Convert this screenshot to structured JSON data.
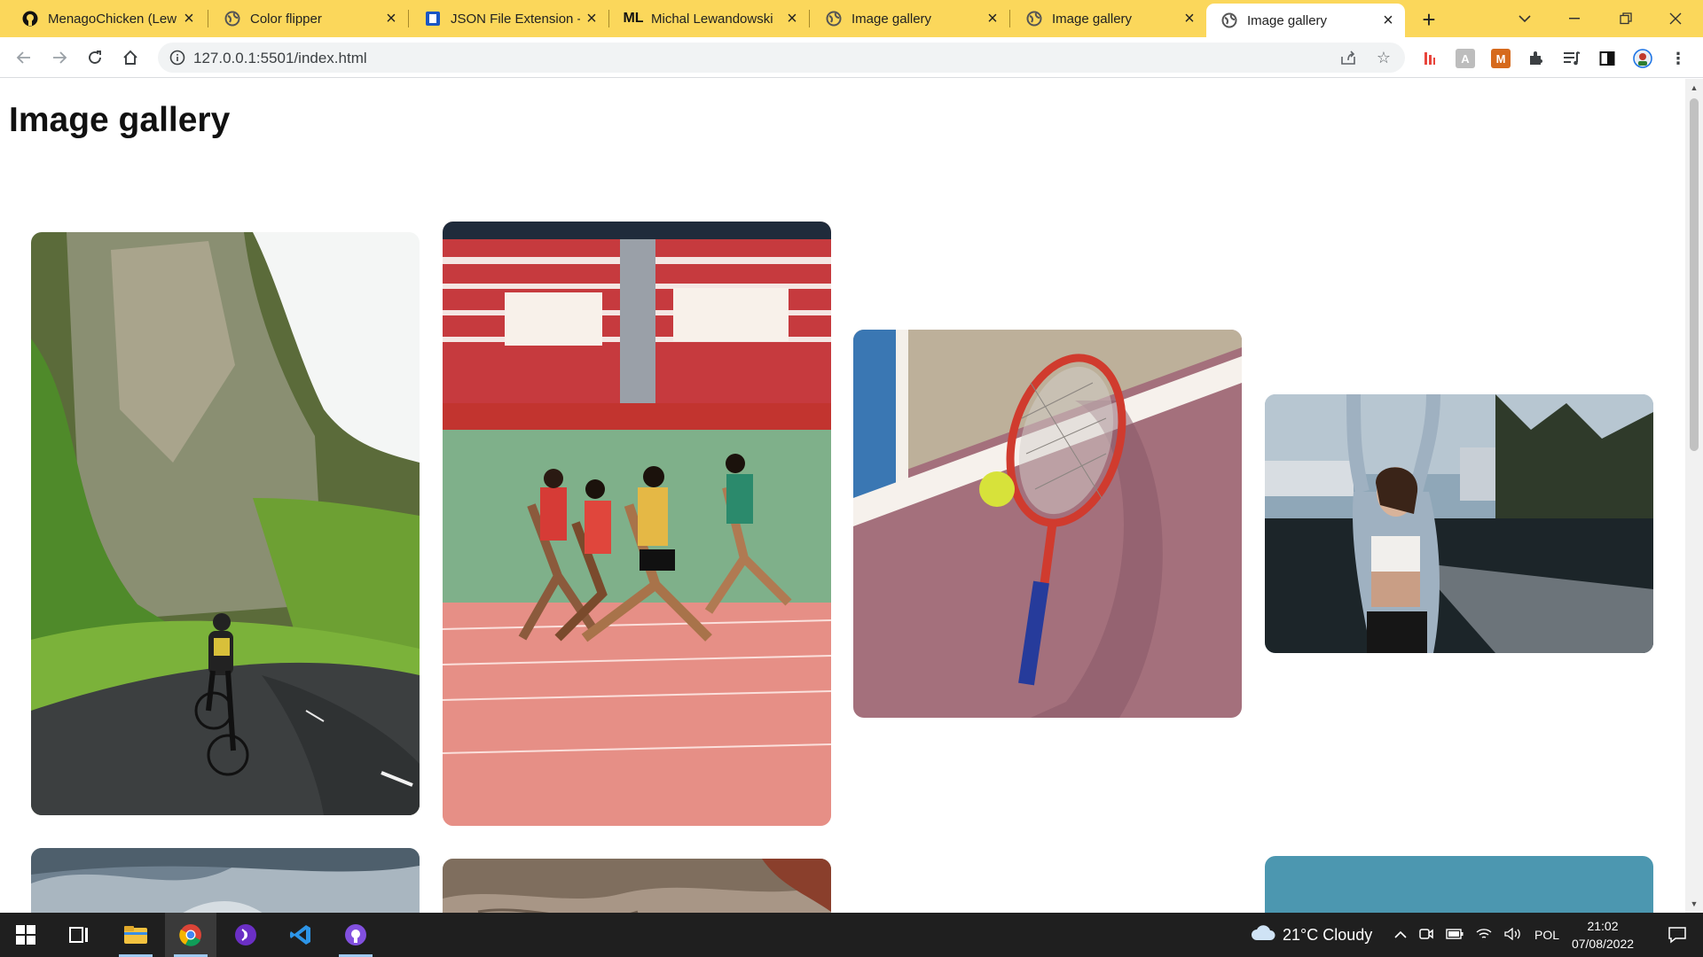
{
  "browser": {
    "tabs": [
      {
        "title": "MenagoChicken (Lew",
        "icon": "github-icon",
        "active": false
      },
      {
        "title": "Color flipper",
        "icon": "globe-icon",
        "active": false
      },
      {
        "title": "JSON File Extension -",
        "icon": "document-icon",
        "active": false
      },
      {
        "title": "Michal Lewandowski",
        "icon": "ml-icon",
        "active": false
      },
      {
        "title": "Image gallery",
        "icon": "globe-icon",
        "active": false
      },
      {
        "title": "Image gallery",
        "icon": "globe-icon",
        "active": false
      },
      {
        "title": "Image gallery",
        "icon": "globe-icon",
        "active": true
      }
    ],
    "url": "127.0.0.1:5501/index.html",
    "accent": "#fbd75b"
  },
  "page": {
    "title": "Image gallery",
    "photos": [
      {
        "subject": "cyclist on mountain road"
      },
      {
        "subject": "women sprinting on track"
      },
      {
        "subject": "tennis racket and ball"
      },
      {
        "subject": "woman stretching by the water"
      },
      {
        "subject": "cloudy sky"
      },
      {
        "subject": "stone texture"
      },
      {
        "subject": "teal backdrop"
      }
    ]
  },
  "taskbar": {
    "apps": [
      "windows-start-icon",
      "task-view-icon",
      "file-explorer-icon",
      "chrome-icon",
      "podcast-app-icon",
      "vscode-icon",
      "github-desktop-icon"
    ],
    "weather": "21°C  Cloudy",
    "language": "POL",
    "time": "21:02",
    "date": "07/08/2022"
  }
}
